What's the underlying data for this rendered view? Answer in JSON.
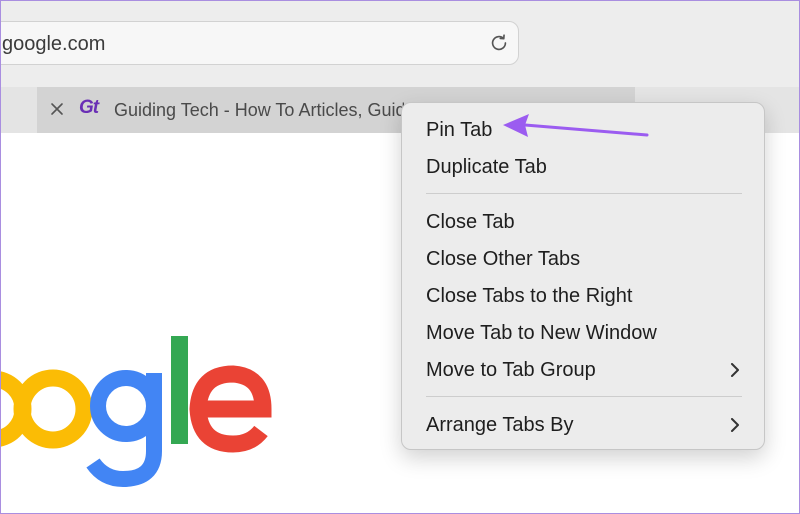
{
  "address_bar": {
    "url": "google.com"
  },
  "tab": {
    "title": "Guiding Tech - How To Articles, Guides, News",
    "favicon_text": "Gt"
  },
  "context_menu": {
    "items": [
      {
        "label": "Pin Tab"
      },
      {
        "label": "Duplicate Tab"
      },
      {
        "label": "Close Tab"
      },
      {
        "label": "Close Other Tabs"
      },
      {
        "label": "Close Tabs to the Right"
      },
      {
        "label": "Move Tab to New Window"
      },
      {
        "label": "Move to Tab Group",
        "submenu": true
      },
      {
        "label": "Arrange Tabs By",
        "submenu": true
      }
    ]
  },
  "logo": {
    "letters": [
      "o",
      "o",
      "g",
      "l",
      "e"
    ]
  },
  "colors": {
    "annotation_arrow": "#9b5cf0",
    "frame_border": "#a98ee0",
    "google_blue": "#4285f4",
    "google_red": "#ea4335",
    "google_yellow": "#fbbc05",
    "google_green": "#34a853"
  },
  "icons": {
    "reload": "reload-icon",
    "tab_close": "close-icon",
    "submenu": "chevron-right-icon"
  }
}
